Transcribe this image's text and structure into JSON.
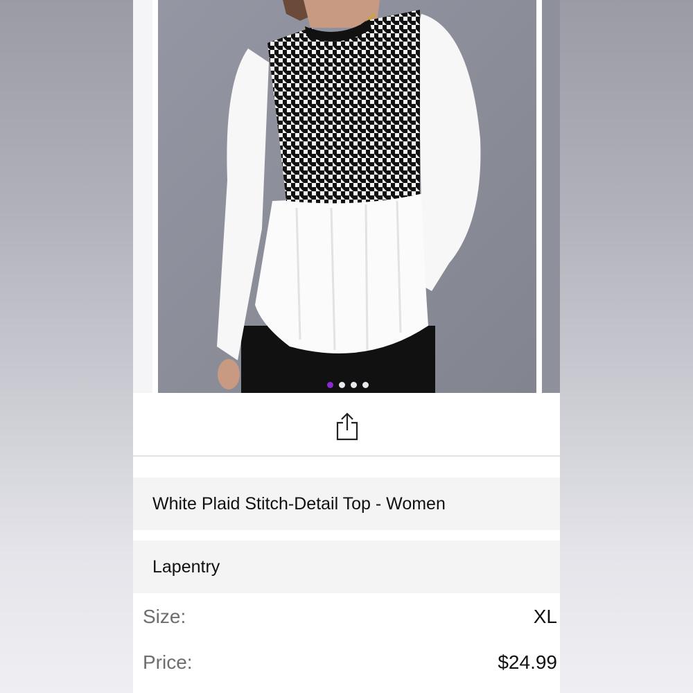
{
  "gallery": {
    "image_description_icon": "product-photo",
    "slide_count": 4,
    "active_slide": 1
  },
  "share": {
    "icon": "share-icon"
  },
  "product": {
    "title": "White Plaid Stitch-Detail Top - Women",
    "brand": "Lapentry"
  },
  "details": {
    "size_label": "Size:",
    "size_value": "XL",
    "price_label": "Price:",
    "price_value": "$24.99"
  },
  "colors": {
    "accent": "#8a2bd1",
    "background": "#ffffff",
    "row_bg": "#f4f4f4"
  }
}
